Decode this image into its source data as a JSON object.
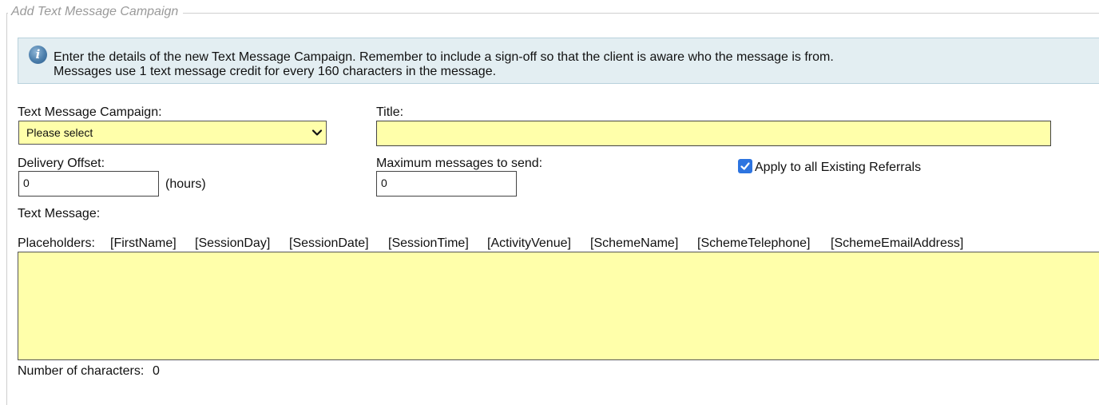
{
  "form": {
    "legend": "Add Text Message Campaign",
    "info": {
      "icon": "info-icon",
      "line1": "Enter the details of the new Text Message Campaign. Remember to include a sign-off so that the client is aware who the message is from.",
      "line2": "Messages use 1 text message credit for every 160 characters in the message."
    },
    "campaign": {
      "label": "Text Message Campaign:",
      "selected": "Please select"
    },
    "title": {
      "label": "Title:",
      "value": ""
    },
    "delivery_offset": {
      "label": "Delivery Offset:",
      "value": "0",
      "unit": "(hours)"
    },
    "max_messages": {
      "label": "Maximum messages to send:",
      "value": "0"
    },
    "apply_existing": {
      "label": "Apply to all Existing Referrals",
      "checked": true
    },
    "text_message": {
      "label": "Text Message:",
      "value": ""
    },
    "placeholders": {
      "label": "Placeholders:",
      "items": [
        "[FirstName]",
        "[SessionDay]",
        "[SessionDate]",
        "[SessionTime]",
        "[ActivityVenue]",
        "[SchemeName]",
        "[SchemeTelephone]",
        "[SchemeEmailAddress]"
      ]
    },
    "char_count": {
      "label": "Number of characters:",
      "value": "0"
    }
  },
  "colors": {
    "field_bg": "#ffffaa",
    "info_bg": "#e3eef2",
    "checkbox": "#2d74e0"
  }
}
